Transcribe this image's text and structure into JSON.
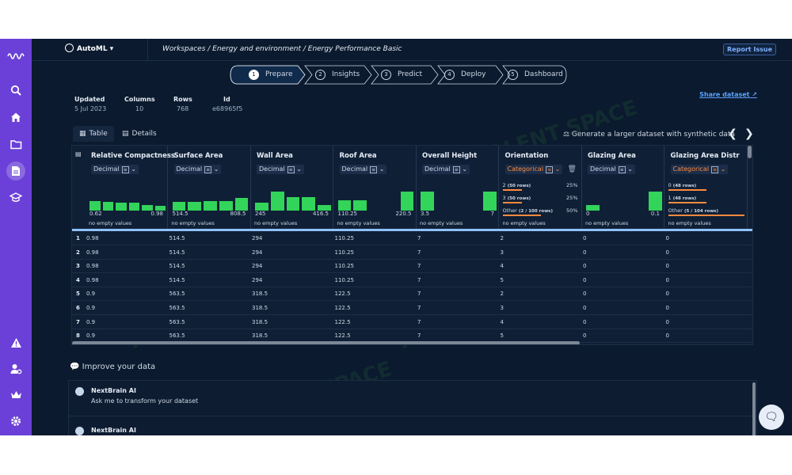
{
  "brand": {
    "name": "AutoML ▾"
  },
  "breadcrumb": "Workspaces  /  Energy and environment  /  Energy Performance Basic",
  "report_issue": "Report Issue",
  "steps": [
    {
      "num": "1",
      "label": "Prepare"
    },
    {
      "num": "2",
      "label": "Insights"
    },
    {
      "num": "3",
      "label": "Predict"
    },
    {
      "num": "4",
      "label": "Deploy"
    },
    {
      "num": "5",
      "label": "Dashboard"
    }
  ],
  "meta": {
    "updated_k": "Updated",
    "updated_v": "5 Jul 2023",
    "columns_k": "Columns",
    "columns_v": "10",
    "rows_k": "Rows",
    "rows_v": "768",
    "id_k": "Id",
    "id_v": "e68965f5"
  },
  "share": "Share dataset",
  "tabs": {
    "table": "Table",
    "details": "Details"
  },
  "synthetic": "Generate a larger dataset with synthetic data",
  "columns": [
    {
      "name": "Relative Compactness",
      "type": "Decimal",
      "min": "0.62",
      "max": "0.98",
      "empty": "no empty values",
      "hist": [
        0.5,
        0.45,
        0.4,
        0.4,
        0.3,
        0.25
      ]
    },
    {
      "name": "Surface Area",
      "type": "Decimal",
      "min": "514.5",
      "max": "808.5",
      "empty": "no empty values",
      "hist": [
        0.45,
        0.45,
        0.5,
        0.5,
        0.65
      ]
    },
    {
      "name": "Wall Area",
      "type": "Decimal",
      "min": "245",
      "max": "416.5",
      "empty": "no empty values",
      "hist": [
        0.4,
        1.0,
        0.7,
        0.7,
        0.3
      ]
    },
    {
      "name": "Roof Area",
      "type": "Decimal",
      "min": "110.25",
      "max": "220.5",
      "empty": "no empty values",
      "hist": [
        0.55,
        0.55,
        0.0,
        0.0,
        1.0
      ]
    },
    {
      "name": "Overall Height",
      "type": "Decimal",
      "min": "3.5",
      "max": "7",
      "empty": "no empty values",
      "hist": [
        1.0,
        0.0,
        0.0,
        0.0,
        1.0
      ]
    },
    {
      "name": "Orientation",
      "type": "Categorical",
      "empty": "no empty values",
      "cats": [
        {
          "label": "2",
          "rows": "(50 rows)",
          "pct": "25%",
          "share": 0.25
        },
        {
          "label": "3",
          "rows": "(50 rows)",
          "pct": "25%",
          "share": 0.25
        },
        {
          "label": "Other",
          "rows": "(2 / 100 rows)",
          "pct": "50%",
          "share": 0.5
        }
      ]
    },
    {
      "name": "Glazing Area",
      "type": "Decimal",
      "min": "0",
      "max": "0.1",
      "empty": "no empty values",
      "hist": [
        0.3,
        0.0,
        0.0,
        0.0,
        1.0
      ]
    },
    {
      "name": "Glazing Area Distr",
      "type": "Categorical",
      "empty": "no empty values",
      "cats": [
        {
          "label": "0",
          "rows": "(48 rows)",
          "pct": "",
          "share": 0.5
        },
        {
          "label": "1",
          "rows": "(48 rows)",
          "pct": "",
          "share": 0.5
        },
        {
          "label": "Other",
          "rows": "(5 / 104 rows)",
          "pct": "",
          "share": 1.0
        }
      ]
    }
  ],
  "rows": [
    [
      "1",
      "0.98",
      "514.5",
      "294",
      "110.25",
      "7",
      "2",
      "0",
      "0"
    ],
    [
      "2",
      "0.98",
      "514.5",
      "294",
      "110.25",
      "7",
      "3",
      "0",
      "0"
    ],
    [
      "3",
      "0.98",
      "514.5",
      "294",
      "110.25",
      "7",
      "4",
      "0",
      "0"
    ],
    [
      "4",
      "0.98",
      "514.5",
      "294",
      "110.25",
      "7",
      "5",
      "0",
      "0"
    ],
    [
      "5",
      "0.9",
      "563.5",
      "318.5",
      "122.5",
      "7",
      "2",
      "0",
      "0"
    ],
    [
      "6",
      "0.9",
      "563.5",
      "318.5",
      "122.5",
      "7",
      "3",
      "0",
      "0"
    ],
    [
      "7",
      "0.9",
      "563.5",
      "318.5",
      "122.5",
      "7",
      "4",
      "0",
      "0"
    ],
    [
      "8",
      "0.9",
      "563.5",
      "318.5",
      "122.5",
      "7",
      "5",
      "0",
      "0"
    ]
  ],
  "improve": "Improve your data",
  "messages": [
    {
      "name": "NextBrain AI",
      "text": "Ask me to transform your dataset"
    },
    {
      "name": "NextBrain AI",
      "text": ""
    }
  ],
  "watermark": "AI TALENT SPACE",
  "colors": {
    "sidebar": "#6a40d8",
    "background": "#0b1a2e",
    "histogram": "#33d45a",
    "categorical": "#ff8a3d",
    "link": "#5aa2ff"
  }
}
